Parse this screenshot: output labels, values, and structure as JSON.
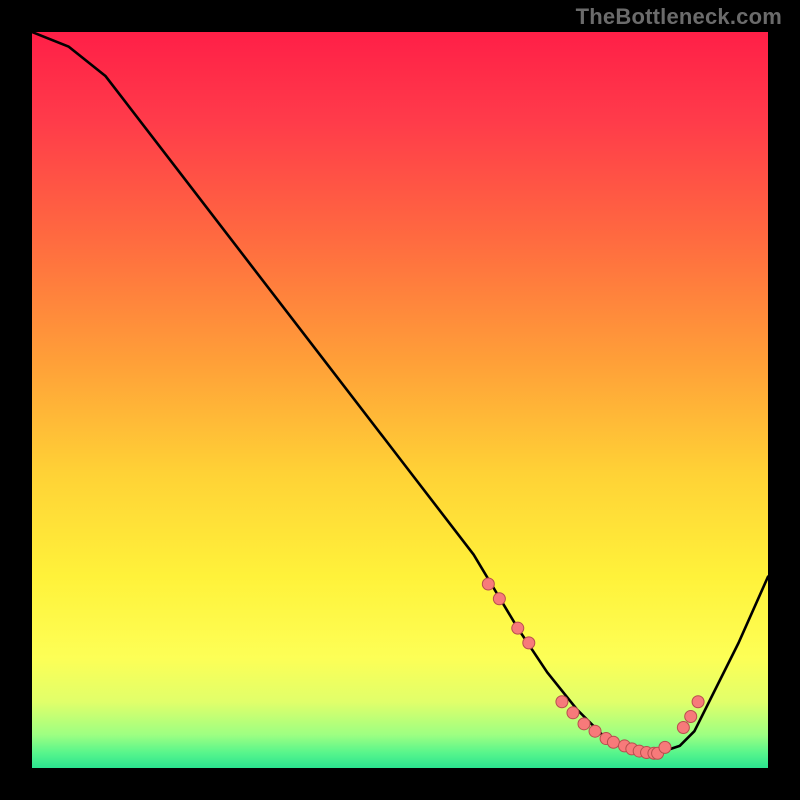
{
  "watermark": "TheBottleneck.com",
  "colors": {
    "page_bg": "#000000",
    "watermark": "#6b6b6b",
    "curve": "#000000",
    "dot_fill": "#f77a7a",
    "dot_stroke": "#b84e4e",
    "gradient_stops": [
      {
        "offset": 0.0,
        "color": "#ff1f47"
      },
      {
        "offset": 0.12,
        "color": "#ff3b4a"
      },
      {
        "offset": 0.28,
        "color": "#ff6a40"
      },
      {
        "offset": 0.45,
        "color": "#ffa038"
      },
      {
        "offset": 0.6,
        "color": "#ffd236"
      },
      {
        "offset": 0.74,
        "color": "#fff23a"
      },
      {
        "offset": 0.85,
        "color": "#fdff56"
      },
      {
        "offset": 0.91,
        "color": "#e1ff6a"
      },
      {
        "offset": 0.955,
        "color": "#9dff82"
      },
      {
        "offset": 0.98,
        "color": "#56f58c"
      },
      {
        "offset": 1.0,
        "color": "#2be38f"
      }
    ]
  },
  "chart_data": {
    "type": "line",
    "title": "",
    "xlabel": "",
    "ylabel": "",
    "xlim": [
      0,
      100
    ],
    "ylim": [
      0,
      100
    ],
    "grid": false,
    "legend": false,
    "series": [
      {
        "name": "curve",
        "x": [
          0,
          5,
          10,
          20,
          30,
          40,
          50,
          60,
          63,
          66,
          70,
          74,
          78,
          82,
          85,
          88,
          90,
          92,
          96,
          100
        ],
        "y": [
          100,
          98,
          94,
          81,
          68,
          55,
          42,
          29,
          24,
          19,
          13,
          8,
          4,
          2,
          2,
          3,
          5,
          9,
          17,
          26
        ]
      }
    ],
    "highlighted_points": {
      "name": "dots",
      "x": [
        62,
        63.5,
        66,
        67.5,
        72,
        73.5,
        75,
        76.5,
        78,
        79,
        80.5,
        81.5,
        82.5,
        83.5,
        84.5,
        85,
        86,
        88.5,
        89.5,
        90.5
      ],
      "y": [
        25,
        23,
        19,
        17,
        9,
        7.5,
        6,
        5,
        4,
        3.5,
        3,
        2.6,
        2.3,
        2.1,
        2.0,
        2.0,
        2.8,
        5.5,
        7.0,
        9.0
      ]
    }
  }
}
